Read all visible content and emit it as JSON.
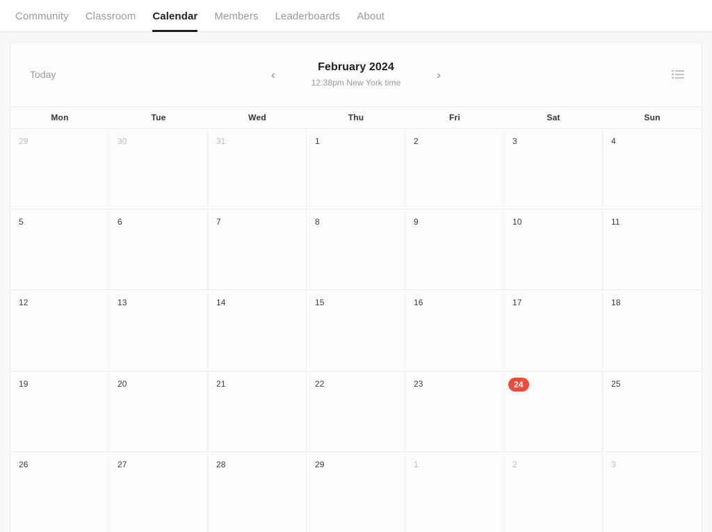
{
  "nav": {
    "items": [
      {
        "label": "Community",
        "active": false,
        "name": "nav-item-community"
      },
      {
        "label": "Classroom",
        "active": false,
        "name": "nav-item-classroom"
      },
      {
        "label": "Calendar",
        "active": true,
        "name": "nav-item-calendar"
      },
      {
        "label": "Members",
        "active": false,
        "name": "nav-item-members"
      },
      {
        "label": "Leaderboards",
        "active": false,
        "name": "nav-item-leaderboards"
      },
      {
        "label": "About",
        "active": false,
        "name": "nav-item-about"
      }
    ]
  },
  "toolbar": {
    "today_label": "Today",
    "prev_label": "‹",
    "next_label": "›",
    "month_title": "February 2024",
    "time_label": "12:38pm New York time",
    "view_toggle_icon": "list-view-icon"
  },
  "calendar": {
    "weekdays": [
      "Mon",
      "Tue",
      "Wed",
      "Thu",
      "Fri",
      "Sat",
      "Sun"
    ],
    "today_accent_color": "#ef4a3a",
    "weeks": [
      [
        {
          "day": "29",
          "muted": true,
          "today": false
        },
        {
          "day": "30",
          "muted": true,
          "today": false
        },
        {
          "day": "31",
          "muted": true,
          "today": false
        },
        {
          "day": "1",
          "muted": false,
          "today": false
        },
        {
          "day": "2",
          "muted": false,
          "today": false
        },
        {
          "day": "3",
          "muted": false,
          "today": false
        },
        {
          "day": "4",
          "muted": false,
          "today": false
        }
      ],
      [
        {
          "day": "5",
          "muted": false,
          "today": false
        },
        {
          "day": "6",
          "muted": false,
          "today": false
        },
        {
          "day": "7",
          "muted": false,
          "today": false
        },
        {
          "day": "8",
          "muted": false,
          "today": false
        },
        {
          "day": "9",
          "muted": false,
          "today": false
        },
        {
          "day": "10",
          "muted": false,
          "today": false
        },
        {
          "day": "11",
          "muted": false,
          "today": false
        }
      ],
      [
        {
          "day": "12",
          "muted": false,
          "today": false
        },
        {
          "day": "13",
          "muted": false,
          "today": false
        },
        {
          "day": "14",
          "muted": false,
          "today": false
        },
        {
          "day": "15",
          "muted": false,
          "today": false
        },
        {
          "day": "16",
          "muted": false,
          "today": false
        },
        {
          "day": "17",
          "muted": false,
          "today": false
        },
        {
          "day": "18",
          "muted": false,
          "today": false
        }
      ],
      [
        {
          "day": "19",
          "muted": false,
          "today": false
        },
        {
          "day": "20",
          "muted": false,
          "today": false
        },
        {
          "day": "21",
          "muted": false,
          "today": false
        },
        {
          "day": "22",
          "muted": false,
          "today": false
        },
        {
          "day": "23",
          "muted": false,
          "today": false
        },
        {
          "day": "24",
          "muted": false,
          "today": true
        },
        {
          "day": "25",
          "muted": false,
          "today": false
        }
      ],
      [
        {
          "day": "26",
          "muted": false,
          "today": false
        },
        {
          "day": "27",
          "muted": false,
          "today": false
        },
        {
          "day": "28",
          "muted": false,
          "today": false
        },
        {
          "day": "29",
          "muted": false,
          "today": false
        },
        {
          "day": "1",
          "muted": true,
          "today": false
        },
        {
          "day": "2",
          "muted": true,
          "today": false
        },
        {
          "day": "3",
          "muted": true,
          "today": false
        }
      ]
    ]
  }
}
